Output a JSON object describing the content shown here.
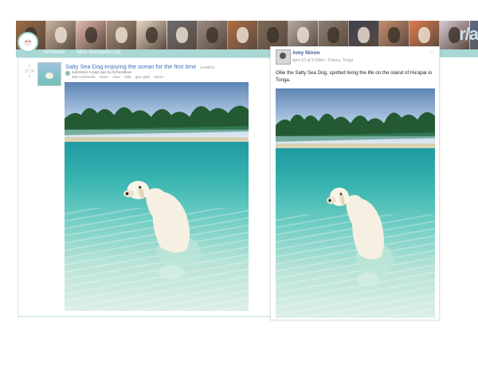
{
  "banner": {
    "tiles": [
      "#9a6b45",
      "#c9b39d",
      "#e7b9b4",
      "#a6937d",
      "#e6d7c3",
      "#6d6d72",
      "#9c8b83",
      "#b06f45",
      "#7c6a58",
      "#b4aaa3",
      "#8d7f73",
      "#3c4150",
      "#c68d6d",
      "#e07c4b",
      "#d8c9d6",
      "#5b6d86"
    ],
    "brand_text": "r/a"
  },
  "tabbar": {
    "items": [
      "comments",
      "other discussions (3)"
    ]
  },
  "post": {
    "score": "37.3k",
    "up_icon": "upvote-arrow-icon",
    "down_icon": "downvote-arrow-icon",
    "title": "Salty Sea Dog enjoying the ocean for the first time",
    "domain": "(i.redd.it)",
    "meta": "submitted 3 days ago by flyTacoBoat",
    "links": [
      "308 comments",
      "share",
      "save",
      "hide",
      "give gold",
      "report"
    ]
  },
  "fb": {
    "name": "Amy Nixon",
    "time": "April 10 at 9:20pm · Foleva, Tonga",
    "chevron_icon": "chevron-down-icon",
    "text": "Ollie the Salty Sea Dog, spotted living the life on the island of Ha'apai in Tonga."
  },
  "colors": {
    "title_link": "#3f6fb4",
    "fb_name": "#3b5998",
    "tabbar": "#a8d8d4"
  }
}
